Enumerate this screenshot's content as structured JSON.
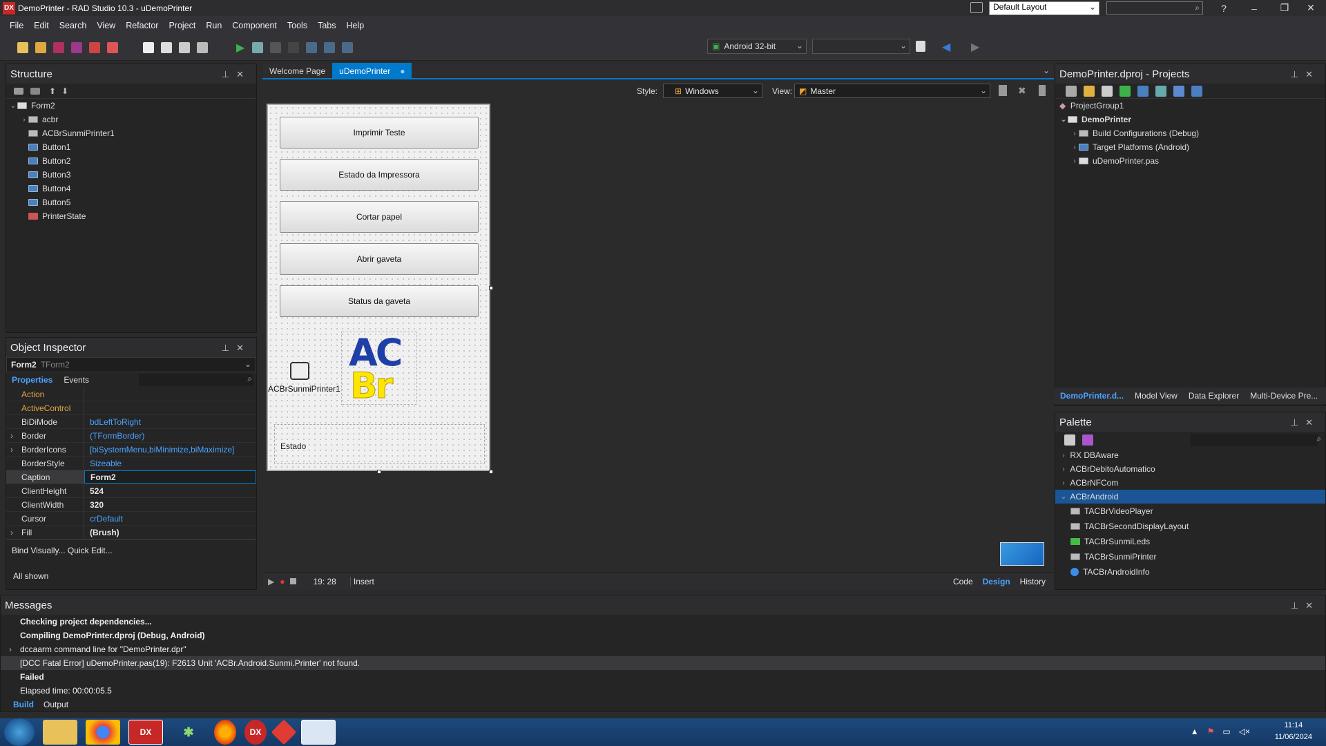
{
  "window": {
    "title": "DemoPrinter - RAD Studio 10.3 - uDemoPrinter",
    "layout_value": "Default Layout",
    "min": "–",
    "max": "❐",
    "close": "✕",
    "help": "?"
  },
  "menu": [
    "File",
    "Edit",
    "Search",
    "View",
    "Refactor",
    "Project",
    "Run",
    "Component",
    "Tools",
    "Tabs",
    "Help"
  ],
  "toolbar": {
    "platform": "Android 32-bit"
  },
  "structure": {
    "title": "Structure",
    "root": "Form2",
    "items": [
      "acbr",
      "ACBrSunmiPrinter1",
      "Button1",
      "Button2",
      "Button3",
      "Button4",
      "Button5",
      "PrinterState"
    ]
  },
  "object_inspector": {
    "title": "Object Inspector",
    "selected_name": "Form2",
    "selected_type": "TForm2",
    "tab_properties": "Properties",
    "tab_events": "Events",
    "rows": [
      {
        "k": "Action",
        "v": ""
      },
      {
        "k": "ActiveControl",
        "v": ""
      },
      {
        "k": "BiDiMode",
        "v": "bdLeftToRight"
      },
      {
        "k": "Border",
        "v": "(TFormBorder)"
      },
      {
        "k": "BorderIcons",
        "v": "[biSystemMenu,biMinimize,biMaximize]"
      },
      {
        "k": "BorderStyle",
        "v": "Sizeable"
      },
      {
        "k": "Caption",
        "v": "Form2"
      },
      {
        "k": "ClientHeight",
        "v": "524"
      },
      {
        "k": "ClientWidth",
        "v": "320"
      },
      {
        "k": "Cursor",
        "v": "crDefault"
      },
      {
        "k": "Fill",
        "v": "(Brush)"
      }
    ],
    "footer_links": "Bind Visually... Quick Edit...",
    "footer_status": "All shown"
  },
  "editor": {
    "tabs": [
      "Welcome Page",
      "uDemoPrinter"
    ],
    "style_label": "Style:",
    "style_value": "Windows",
    "view_label": "View:",
    "view_value": "Master",
    "form_buttons": [
      "Imprimir Teste",
      "Estado da Impressora",
      "Cortar papel",
      "Abrir gaveta",
      "Status da gaveta"
    ],
    "component_label": "ACBrSunmiPrinter1",
    "logo_top": "AC",
    "logo_bottom": "Br",
    "estado_label": "Estado",
    "status_pos": "19: 28",
    "status_mode": "Insert",
    "bottom_tabs": [
      "Code",
      "Design",
      "History"
    ]
  },
  "projects": {
    "title": "DemoPrinter.dproj - Projects",
    "tree": [
      "ProjectGroup1",
      "DemoPrinter",
      "Build Configurations (Debug)",
      "Target Platforms (Android)",
      "uDemoPrinter.pas"
    ],
    "tabs": [
      "DemoPrinter.d...",
      "Model View",
      "Data Explorer",
      "Multi-Device Pre..."
    ]
  },
  "palette": {
    "title": "Palette",
    "groups": [
      "RX DBAware",
      "ACBrDebitoAutomatico",
      "ACBrNFCom",
      "ACBrAndroid"
    ],
    "items": [
      "TACBrVideoPlayer",
      "TACBrSecondDisplayLayout",
      "TACBrSunmiLeds",
      "TACBrSunmiPrinter",
      "TACBrAndroidInfo"
    ]
  },
  "messages": {
    "title": "Messages",
    "lines": [
      "Checking project dependencies...",
      "Compiling DemoPrinter.dproj (Debug, Android)",
      "dccaarm command line for \"DemoPrinter.dpr\"",
      "[DCC Fatal Error] uDemoPrinter.pas(19): F2613 Unit 'ACBr.Android.Sunmi.Printer' not found.",
      "Failed",
      "Elapsed time: 00:00:05.5"
    ],
    "tabs": [
      "Build",
      "Output"
    ]
  },
  "taskbar": {
    "time": "11:14",
    "date": "11/06/2024"
  }
}
